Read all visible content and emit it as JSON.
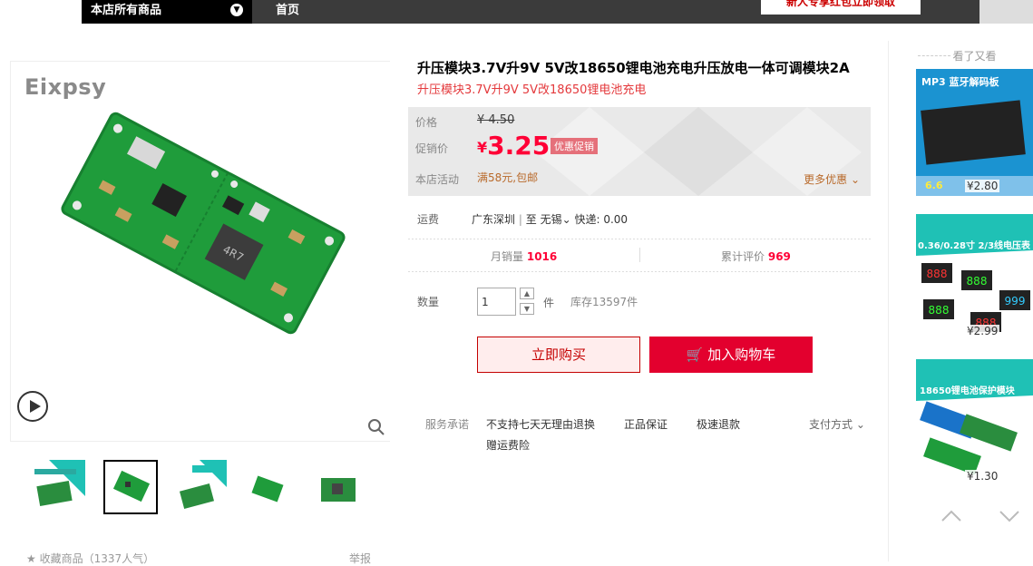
{
  "top_nav": {
    "category_menu": "本店所有商品",
    "home": "首页",
    "promo_button": "新人专享红包立即领取"
  },
  "gallery": {
    "brand_logo": "Eixpsy",
    "thumbs": [
      "thumb-1",
      "thumb-2",
      "thumb-3",
      "thumb-4",
      "thumb-5"
    ],
    "active_thumb_index": 1
  },
  "favorites": {
    "label": "收藏商品",
    "count": "（1337人气）",
    "report": "举报"
  },
  "product": {
    "title": "升压模块3.7V升9V 5V改18650锂电池充电升压放电一体可调模块2A",
    "subtitle": "升压模块3.7V升9V 5V改18650锂电池充电",
    "price_label": "价格",
    "original_price": "¥ 4.50",
    "promo_label": "促销价",
    "currency": "¥",
    "promo_price": "3.25",
    "promo_tag": "优惠促销",
    "activity_label": "本店活动",
    "activity_text": "满58元,包邮",
    "more_discounts": "更多优惠",
    "shipping_label": "运费",
    "shipping_from": "广东深圳",
    "shipping_to_prefix": "至",
    "shipping_to": "无锡",
    "shipping_method": "快递: 0.00",
    "monthly_sales_label": "月销量",
    "monthly_sales": "1016",
    "reviews_label": "累计评价",
    "reviews": "969",
    "qty_label": "数量",
    "qty_value": "1",
    "unit": "件",
    "stock": "库存13597件",
    "buy_now": "立即购买",
    "add_to_cart": "加入购物车",
    "service_label": "服务承诺",
    "services": [
      "不支持七天无理由退换",
      "正品保证",
      "极速退款",
      "赠运费险"
    ],
    "payment": "支付方式"
  },
  "seen_also": {
    "title": "看了又看",
    "items": [
      {
        "banner": "MP3 蓝牙解码板",
        "price": "¥2.80",
        "tag": "6.6"
      },
      {
        "banner": "0.36/0.28寸 2/3线电压表",
        "price": "¥2.99"
      },
      {
        "banner": "18650锂电池保护模块",
        "price": "¥1.30"
      }
    ]
  },
  "colors": {
    "accent_red": "#ff0036",
    "cart_red": "#e3002e",
    "top_bar": "#3b3b3b",
    "pcb_green": "#1e9a3a"
  }
}
